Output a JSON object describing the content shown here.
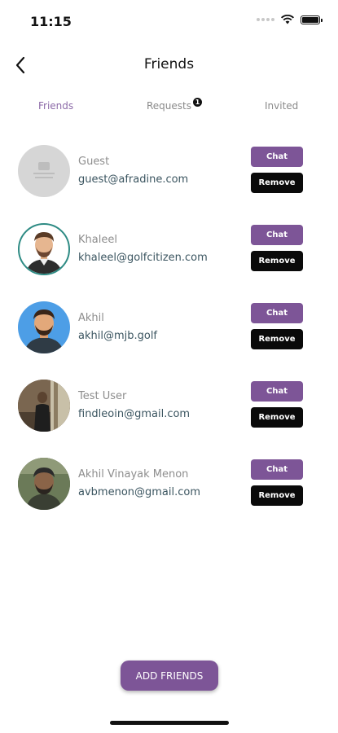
{
  "status_bar": {
    "time": "11:15"
  },
  "header": {
    "title": "Friends"
  },
  "tabs": [
    {
      "label": "Friends",
      "active": true
    },
    {
      "label": "Requests",
      "badge": "1"
    },
    {
      "label": "Invited"
    }
  ],
  "friends": [
    {
      "name": "Guest",
      "email": "guest@afradine.com",
      "avatar_icon": "no-image-placeholder",
      "chat_label": "Chat",
      "remove_label": "Remove"
    },
    {
      "name": "Khaleel",
      "email": "khaleel@golfcitizen.com",
      "avatar_icon": "illustrated-avatar",
      "chat_label": "Chat",
      "remove_label": "Remove"
    },
    {
      "name": "Akhil",
      "email": "akhil@mjb.golf",
      "avatar_icon": "illustrated-avatar",
      "chat_label": "Chat",
      "remove_label": "Remove"
    },
    {
      "name": "Test User",
      "email": "findleoin@gmail.com",
      "avatar_icon": "photo-avatar",
      "chat_label": "Chat",
      "remove_label": "Remove"
    },
    {
      "name": "Akhil Vinayak Menon",
      "email": "avbmenon@gmail.com",
      "avatar_icon": "photo-avatar",
      "chat_label": "Chat",
      "remove_label": "Remove"
    }
  ],
  "add_friends_label": "ADD FRIENDS",
  "colors": {
    "accent": "#7d5597",
    "tab_active": "#8c6aa8",
    "remove_bg": "#0a0a0a",
    "email_text": "#3b5560"
  }
}
